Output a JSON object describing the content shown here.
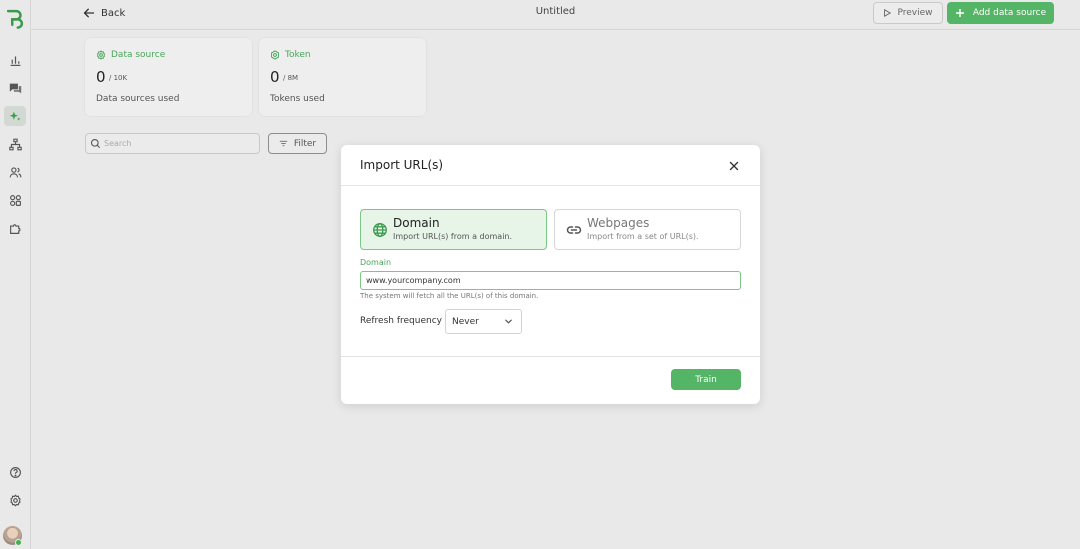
{
  "header": {
    "back_label": "Back",
    "title": "Untitled",
    "preview_label": "Preview",
    "add_label": "Add data source"
  },
  "sidebar": {
    "items": [
      {
        "icon": "bar-chart-icon"
      },
      {
        "icon": "chat-icon"
      },
      {
        "icon": "sparkle-icon",
        "active": true
      },
      {
        "icon": "sitemap-icon"
      },
      {
        "icon": "users-icon"
      },
      {
        "icon": "apps-icon"
      },
      {
        "icon": "puzzle-icon"
      }
    ],
    "bottom": [
      {
        "icon": "help-icon"
      },
      {
        "icon": "settings-icon"
      }
    ]
  },
  "stats": {
    "data_source": {
      "label": "Data source",
      "value": "0",
      "max": "/ 10K",
      "caption": "Data sources used"
    },
    "token": {
      "label": "Token",
      "value": "0",
      "max": "/ 8M",
      "caption": "Tokens used"
    }
  },
  "search": {
    "placeholder": "Search"
  },
  "filter_label": "Filter",
  "modal": {
    "title": "Import URL(s)",
    "options": [
      {
        "title": "Domain",
        "description": "Import URL(s) from a domain.",
        "selected": true
      },
      {
        "title": "Webpages",
        "description": "Import from a set of URL(s).",
        "selected": false
      }
    ],
    "domain_label": "Domain",
    "domain_value": "www.yourcompany.com",
    "hint": "The system will fetch all the URL(s) of this domain.",
    "frequency_label": "Refresh frequency",
    "frequency_value": "Never",
    "train_label": "Train"
  },
  "colors": {
    "accent": "#54b566",
    "accent_text": "#49a55a",
    "selected_bg": "#e7f4e8"
  }
}
